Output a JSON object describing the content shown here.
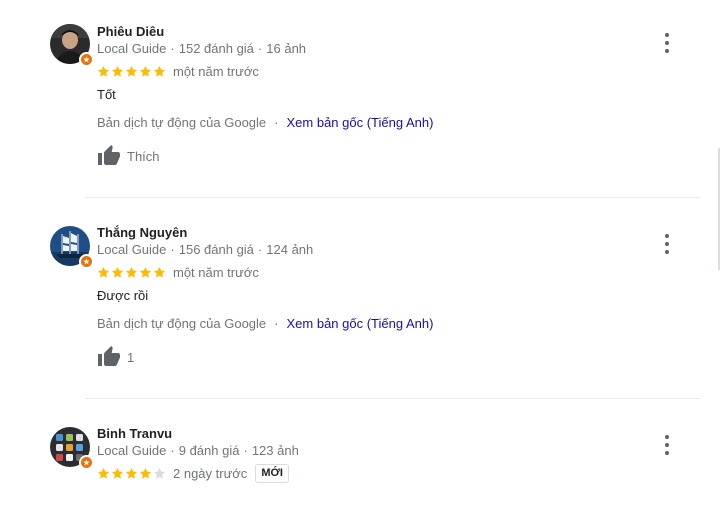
{
  "reviews": [
    {
      "name": "Phiêu Diêu",
      "local_guide": "Local Guide",
      "reviews_count": "152 đánh giá",
      "photos_count": "16 ảnh",
      "rating": 5,
      "time": "một năm trước",
      "text": "Tốt",
      "translated_by": "Bản dịch tự động của Google",
      "see_original": "Xem bản gốc (Tiếng Anh)",
      "like_label": "Thích",
      "avatar_icon": "person-photo-icon"
    },
    {
      "name": "Thắng Nguyên",
      "local_guide": "Local Guide",
      "reviews_count": "156 đánh giá",
      "photos_count": "124 ảnh",
      "rating": 5,
      "time": "một năm trước",
      "text": "Được rồi",
      "translated_by": "Bản dịch tự động của Google",
      "see_original": "Xem bản gốc (Tiếng Anh)",
      "like_label": "1",
      "avatar_icon": "sailing-ship-photo-icon"
    },
    {
      "name": "Binh Tranvu",
      "local_guide": "Local Guide",
      "reviews_count": "9 đánh giá",
      "photos_count": "123 ảnh",
      "rating": 4,
      "time": "2 ngày trước",
      "new_badge": "MỚI",
      "avatar_icon": "app-grid-photo-icon"
    }
  ],
  "colors": {
    "star_filled": "#fbbc04",
    "star_empty": "#dadce0",
    "link": "#1a0dab",
    "guide_badge": "#e8710a"
  }
}
